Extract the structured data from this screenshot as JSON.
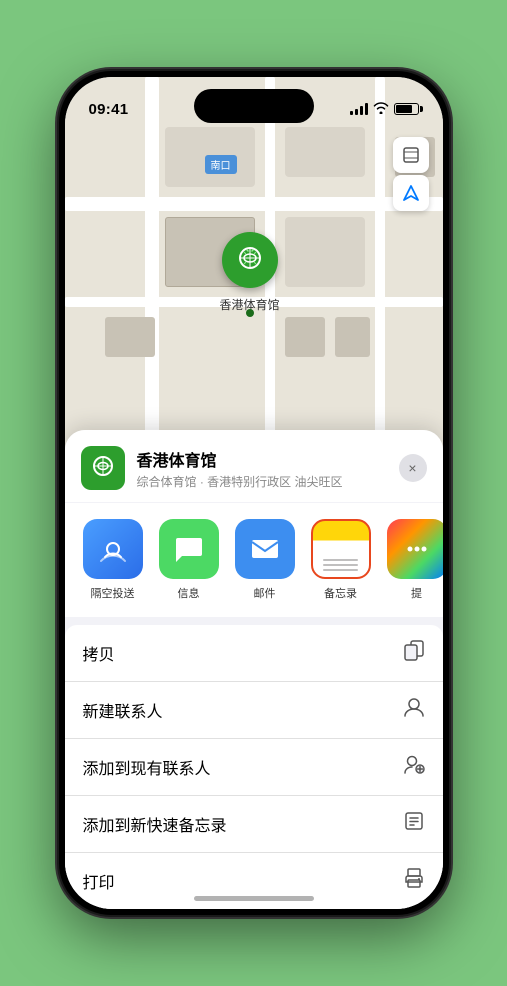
{
  "status_bar": {
    "time": "09:41",
    "navigation_arrow": "▶"
  },
  "map": {
    "label": "南口",
    "venue_pin_label": "香港体育馆"
  },
  "map_controls": {
    "layers_icon": "🗺",
    "location_icon": "↗"
  },
  "bottom_sheet": {
    "venue_name": "香港体育馆",
    "venue_desc": "综合体育馆 · 香港特别行政区 油尖旺区",
    "close_label": "×",
    "share_items": [
      {
        "label": "隔空投送",
        "type": "airdrop"
      },
      {
        "label": "信息",
        "type": "message"
      },
      {
        "label": "邮件",
        "type": "mail"
      },
      {
        "label": "备忘录",
        "type": "notes"
      },
      {
        "label": "提",
        "type": "more"
      }
    ],
    "actions": [
      {
        "label": "拷贝",
        "icon": "⎘"
      },
      {
        "label": "新建联系人",
        "icon": "👤"
      },
      {
        "label": "添加到现有联系人",
        "icon": "👤+"
      },
      {
        "label": "添加到新快速备忘录",
        "icon": "📋"
      },
      {
        "label": "打印",
        "icon": "🖨"
      }
    ]
  }
}
